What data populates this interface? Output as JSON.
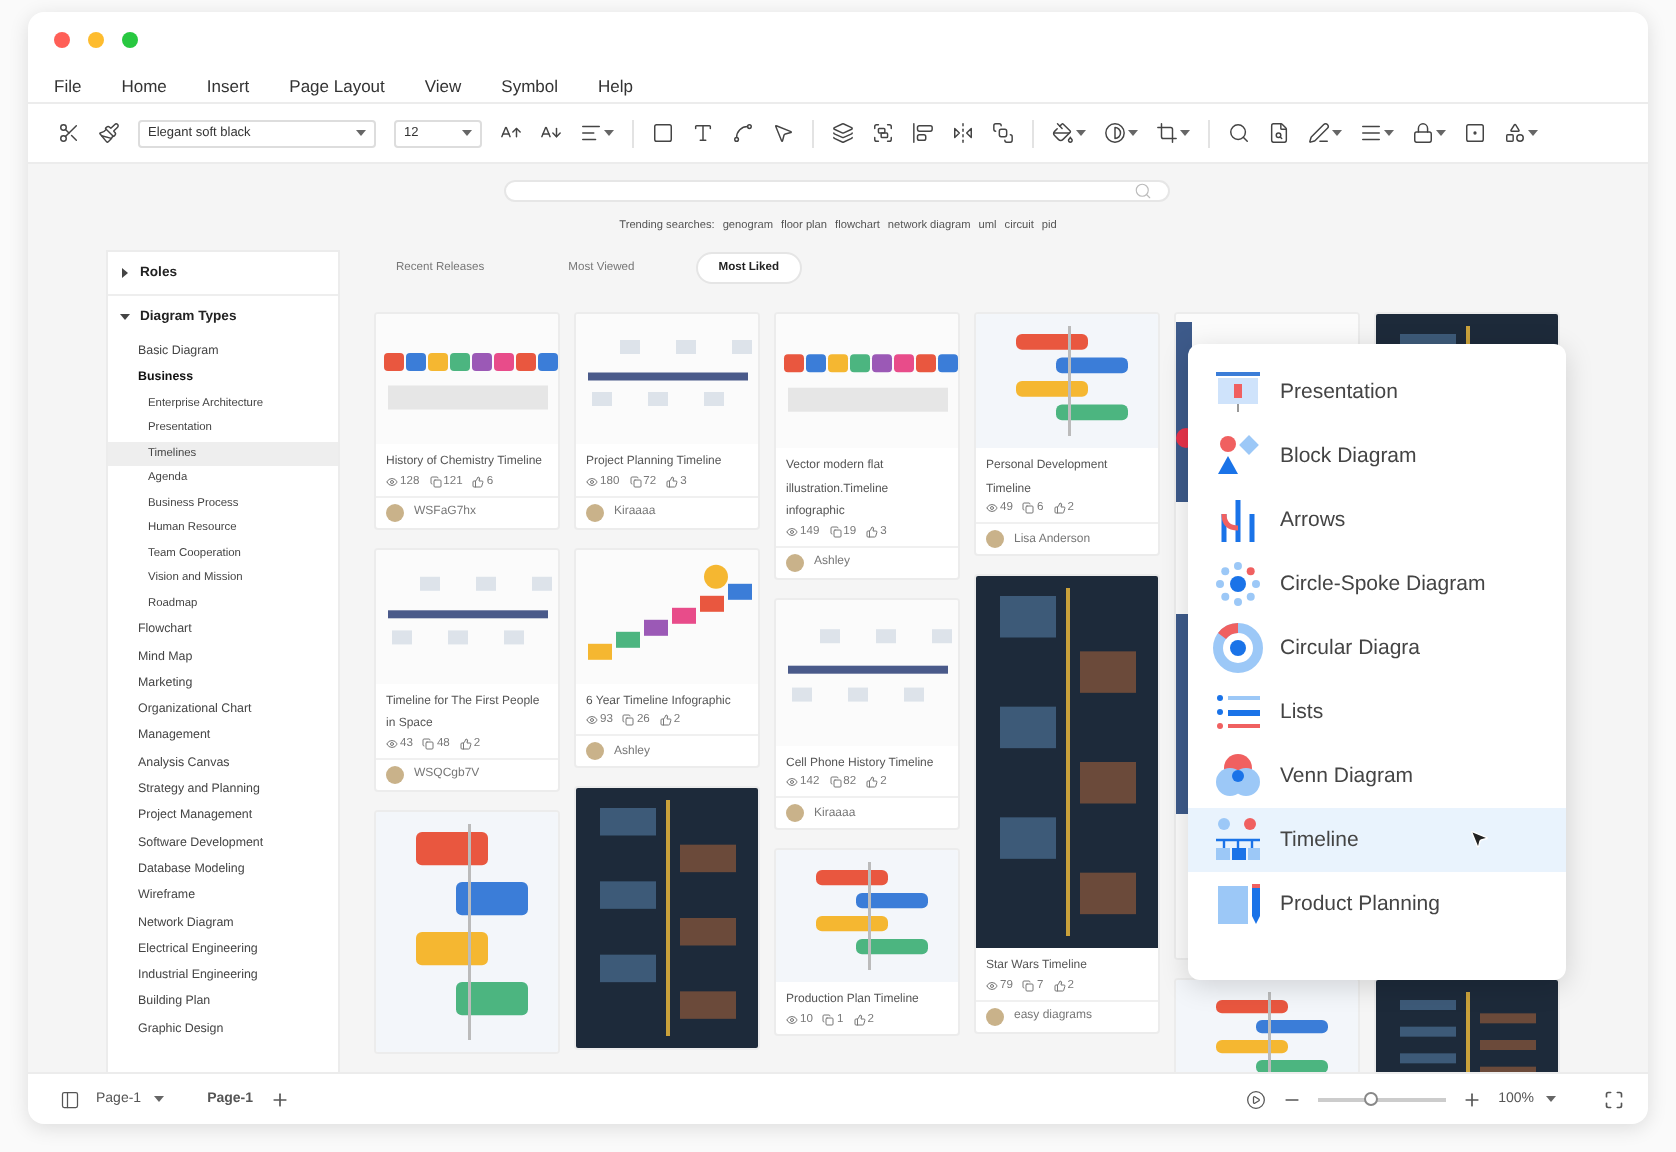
{
  "menu": [
    "File",
    "Home",
    "Insert",
    "Page Layout",
    "View",
    "Symbol",
    "Help"
  ],
  "toolbar": {
    "font": "Elegant soft black",
    "size": "12"
  },
  "trending": {
    "label": "Trending searches:",
    "terms": [
      "genogram",
      "floor plan",
      "flowchart",
      "network diagram",
      "uml",
      "circuit",
      "pid"
    ]
  },
  "sidebar": {
    "sections": [
      {
        "label": "Roles",
        "expanded": false
      },
      {
        "label": "Diagram Types",
        "expanded": true,
        "children": [
          {
            "label": "Basic Diagram",
            "selected": false
          },
          {
            "label": "Business",
            "selected": false,
            "expanded": true,
            "children": [
              {
                "label": "Enterprise Architecture",
                "selected": false
              },
              {
                "label": "Presentation",
                "selected": false
              },
              {
                "label": "Timelines",
                "selected": true
              },
              {
                "label": "Agenda",
                "selected": false
              },
              {
                "label": "Business Process",
                "selected": false
              },
              {
                "label": "Human Resource",
                "selected": false
              },
              {
                "label": "Team Cooperation",
                "selected": false
              },
              {
                "label": "Vision and Mission",
                "selected": false
              },
              {
                "label": "Roadmap",
                "selected": false
              }
            ]
          },
          {
            "label": "Flowchart",
            "selected": false
          },
          {
            "label": "Mind Map",
            "selected": false
          },
          {
            "label": "Marketing",
            "selected": false
          },
          {
            "label": "Organizational Chart",
            "selected": false
          },
          {
            "label": "Management",
            "selected": false
          },
          {
            "label": "Analysis Canvas",
            "selected": false
          },
          {
            "label": "Strategy and Planning",
            "selected": false
          },
          {
            "label": "Project Management",
            "selected": false
          },
          {
            "label": "Software Development",
            "selected": false
          },
          {
            "label": "Database Modeling",
            "selected": false
          },
          {
            "label": "Wireframe",
            "selected": false
          },
          {
            "label": "Network Diagram",
            "selected": false
          },
          {
            "label": "Electrical Engineering",
            "selected": false
          },
          {
            "label": "Industrial Engineering",
            "selected": false
          },
          {
            "label": "Building Plan",
            "selected": false
          },
          {
            "label": "Graphic Design",
            "selected": false
          }
        ]
      }
    ]
  },
  "tabs": [
    {
      "label": "Recent Releases",
      "selected": false
    },
    {
      "label": "Most Viewed",
      "selected": false
    },
    {
      "label": "Most Liked",
      "selected": true
    }
  ],
  "columns": [
    [
      {
        "kind": "template",
        "title": "History of Chemistry Timeline",
        "views": "128",
        "copies": "121",
        "likes": "6",
        "author": "WSFaG7hx"
      },
      {
        "kind": "template",
        "title": "Timeline for The First People in Space",
        "views": "43",
        "copies": "48",
        "likes": "2",
        "author": "WSQCgb7V"
      },
      {
        "kind": "picture"
      }
    ],
    [
      {
        "kind": "template",
        "title": "Project Planning Timeline",
        "views": "180",
        "copies": "72",
        "likes": "3",
        "author": "Kiraaaa"
      },
      {
        "kind": "template",
        "title": "6 Year Timeline Infographic",
        "views": "93",
        "copies": "26",
        "likes": "2",
        "author": "Ashley"
      },
      {
        "kind": "picture"
      }
    ],
    [
      {
        "kind": "template",
        "title": "Vector modern flat illustration.Timeline infographic",
        "views": "149",
        "copies": "19",
        "likes": "3",
        "author": "Ashley"
      },
      {
        "kind": "template",
        "title": "Cell Phone History Timeline",
        "views": "142",
        "copies": "82",
        "likes": "2",
        "author": "Kiraaaa"
      },
      {
        "kind": "template",
        "title": "Production Plan Timeline",
        "views": "10",
        "copies": "1",
        "likes": "2"
      }
    ],
    [
      {
        "kind": "template",
        "title": "Personal Development Timeline",
        "views": "49",
        "copies": "6",
        "likes": "2",
        "author": "Lisa Anderson"
      },
      {
        "kind": "template",
        "title": "Star Wars Timeline",
        "views": "79",
        "copies": "7",
        "likes": "2",
        "author": "easy diagrams"
      }
    ],
    [
      {
        "kind": "picture"
      },
      {
        "kind": "picture"
      }
    ],
    [
      {
        "kind": "picture"
      },
      {
        "kind": "picture"
      }
    ]
  ],
  "category_menu": {
    "items": [
      {
        "label": "Presentation",
        "selected": false
      },
      {
        "label": "Block Diagram",
        "selected": false
      },
      {
        "label": "Arrows",
        "selected": false
      },
      {
        "label": "Circle-Spoke Diagram",
        "selected": false
      },
      {
        "label": "Circular Diagra",
        "selected": false
      },
      {
        "label": "Lists",
        "selected": false
      },
      {
        "label": "Venn Diagram",
        "selected": false
      },
      {
        "label": "Timeline",
        "selected": true
      },
      {
        "label": "Product Planning",
        "selected": false
      }
    ]
  },
  "status_bar": {
    "page_tab": "Page-1",
    "current_page": "Page-1",
    "zoom": {
      "level": 0.42,
      "reading": "100%"
    }
  }
}
